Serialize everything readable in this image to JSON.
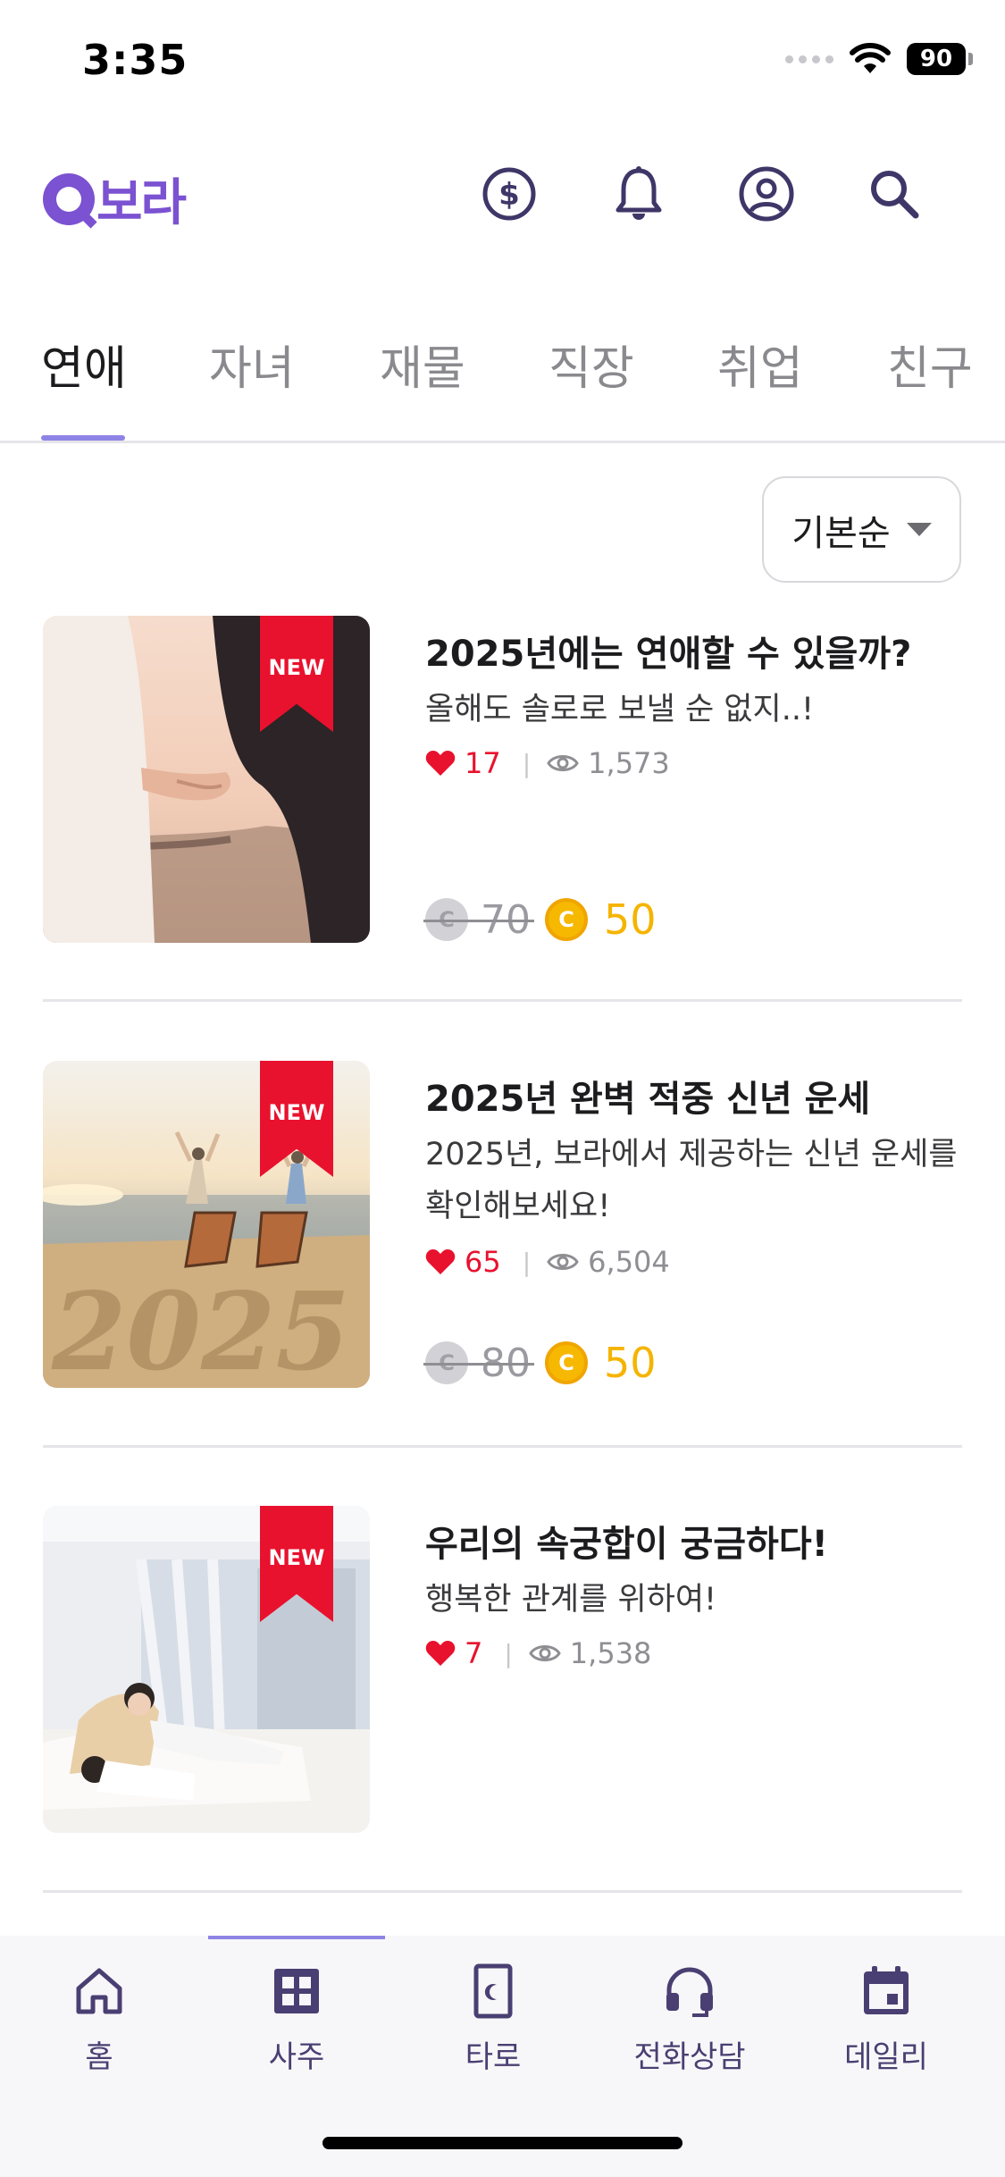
{
  "status_bar": {
    "time": "3:35",
    "battery": "90"
  },
  "header": {
    "logo_text": "보라",
    "icons": [
      "coin-icon",
      "bell-icon",
      "profile-icon",
      "search-icon"
    ],
    "accent_color": "#7b52d1"
  },
  "tabs": [
    {
      "label": "연애",
      "active": true
    },
    {
      "label": "자녀",
      "active": false
    },
    {
      "label": "재물",
      "active": false
    },
    {
      "label": "직장",
      "active": false
    },
    {
      "label": "취업",
      "active": false
    },
    {
      "label": "친구",
      "active": false
    }
  ],
  "sort": {
    "label": "기본순"
  },
  "cards": [
    {
      "badge": "NEW",
      "title": "2025년에는 연애할 수 있을까?",
      "description": "올해도 솔로로 보낼 순 없지..!",
      "likes": "17",
      "views": "1,573",
      "price_old": "70",
      "price_new": "50"
    },
    {
      "badge": "NEW",
      "title": "2025년 완벽 적중 신년 운세",
      "description": "2025년, 보라에서 제공하는 신년 운세를 확인해보세요!",
      "likes": "65",
      "views": "6,504",
      "price_old": "80",
      "price_new": "50"
    },
    {
      "badge": "NEW",
      "title": "우리의 속궁합이 궁금하다!",
      "description": "행복한 관계를 위하여!",
      "likes": "7",
      "views": "1,538"
    }
  ],
  "bottom_nav": [
    {
      "label": "홈",
      "icon": "home-icon",
      "active": false
    },
    {
      "label": "사주",
      "icon": "grid-icon",
      "active": true
    },
    {
      "label": "타로",
      "icon": "tarot-card-icon",
      "active": false
    },
    {
      "label": "전화상담",
      "icon": "headset-icon",
      "active": false
    },
    {
      "label": "데일리",
      "icon": "calendar-icon",
      "active": false
    }
  ]
}
